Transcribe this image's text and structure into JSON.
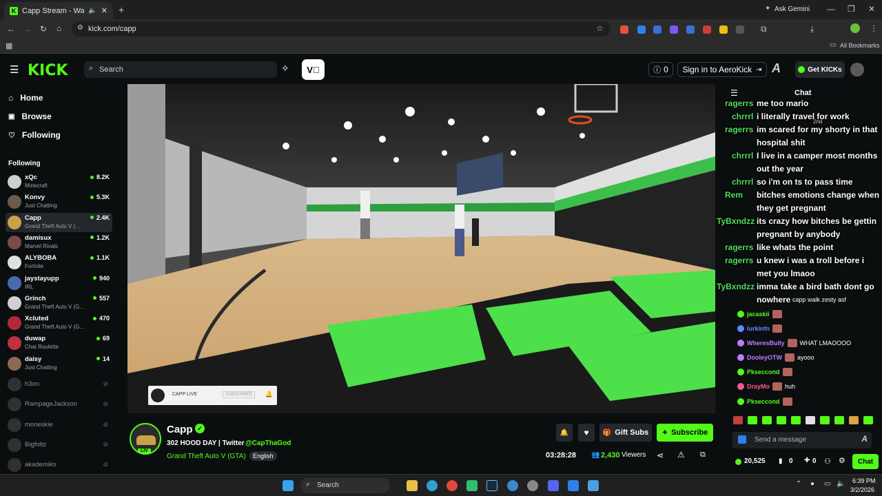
{
  "browser": {
    "tab_title": "Capp Stream - Watch Live …",
    "url": "kick.com/capp",
    "ask_gemini": "Ask Gemini",
    "all_bookmarks": "All Bookmarks"
  },
  "header": {
    "logo": "KICK",
    "search_placeholder": "Search",
    "notif_count": "0",
    "signin_label": "Sign in to AeroKick",
    "get_kicks_label": "Get KICKs"
  },
  "nav": {
    "home": "Home",
    "browse": "Browse",
    "following": "Following",
    "following_heading": "Following"
  },
  "channels": [
    {
      "name": "xQc",
      "game": "Minecraft",
      "viewers": "8.2K",
      "color": "#cfcfcf"
    },
    {
      "name": "Konvy",
      "game": "Just Chatting",
      "viewers": "5.3K",
      "color": "#6b5a4a"
    },
    {
      "name": "Capp",
      "game": "Grand Theft Auto V (…",
      "viewers": "2.4K",
      "color": "#c9a24a"
    },
    {
      "name": "damisux",
      "game": "Marvel Rivals",
      "viewers": "1.2K",
      "color": "#7a4a4a"
    },
    {
      "name": "ALYBOBA",
      "game": "Fortnite",
      "viewers": "1.1K",
      "color": "#e0e0e0"
    },
    {
      "name": "jaystayupp",
      "game": "IRL",
      "viewers": "940",
      "color": "#4a6ab0"
    },
    {
      "name": "Grinch",
      "game": "Grand Theft Auto V (G…",
      "viewers": "557",
      "color": "#d0d0d0"
    },
    {
      "name": "Xcluted",
      "game": "Grand Theft Auto V (G…",
      "viewers": "470",
      "color": "#b02a3a"
    },
    {
      "name": "duwap",
      "game": "Chat Roulette",
      "viewers": "69",
      "color": "#c03040"
    },
    {
      "name": "daisy",
      "game": "Just Chatting",
      "viewers": "14",
      "color": "#8a6a50"
    }
  ],
  "offline_channels": [
    "h3on",
    "RampageJackson",
    "moneskie",
    "Bigfoltz",
    "akademiks"
  ],
  "video_overlay": {
    "name": "CAPP LIVE",
    "status": "SUBSCRIBED"
  },
  "stream": {
    "streamer": "Capp",
    "title_prefix": "302 HOOD DAY | Twitter",
    "twitter": "@CapThaGod",
    "category": "Grand Theft Auto V (GTA)",
    "language": "English",
    "live_tag": "LIV",
    "uptime": "03:28:28",
    "viewers": "2,430",
    "viewers_label": "Viewers",
    "gift_subs": "Gift Subs",
    "subscribe": "Subscribe"
  },
  "chat": {
    "title": "Chat",
    "send_placeholder": "Send a message",
    "points": "20,525",
    "count_a": "0",
    "count_b": "0",
    "chat_button": "Chat",
    "overlay_messages": [
      {
        "user": "ragerrs",
        "text": "me too mario"
      },
      {
        "user": "chrrrl",
        "text": "i literally travel for work"
      },
      {
        "user": "ragerrs",
        "text": "im scared for my shorty in that hospital shit"
      },
      {
        "user": "chrrrl",
        "text": "I live in a camper most months out the year"
      },
      {
        "user": "chrrrl",
        "text": "so i'm on ts to pass time"
      },
      {
        "user": "Rem",
        "text": "bitches emotions change when they get pregnant"
      },
      {
        "user": "TyBxndzz",
        "text": "its crazy how bitches be gettin pregnant by anybody"
      },
      {
        "user": "ragerrs",
        "text": "like whats the point"
      },
      {
        "user": "ragerrs",
        "text": "u knew i was a troll before i met you lmaoo"
      },
      {
        "user": "TyBxndzz",
        "text": "imma take a bird bath dont go nowhere"
      }
    ],
    "bottom_messages": [
      {
        "user": "jacaskii",
        "text": "",
        "color": "#53fc18"
      },
      {
        "user": "lurkinfn",
        "text": "",
        "color": "#5b8cff"
      },
      {
        "user": "WheresBully",
        "text": "WHAT LMAOOOO",
        "color": "#c07cff"
      },
      {
        "user": "DooleyOTW",
        "text": "ayooo",
        "color": "#c07cff"
      },
      {
        "user": "Pkseccond",
        "text": "",
        "color": "#53fc18"
      },
      {
        "user": "DrayMo",
        "text": "huh",
        "color": "#ff5a8a"
      },
      {
        "user": "Pkseccond",
        "text": "",
        "color": "#53fc18"
      }
    ],
    "small_text": {
      "capp_walk": "capp walk zesty asf",
      "rank": "2nd"
    }
  },
  "taskbar": {
    "search": "Search",
    "time": "6:39 PM",
    "date": "3/2/2026"
  }
}
